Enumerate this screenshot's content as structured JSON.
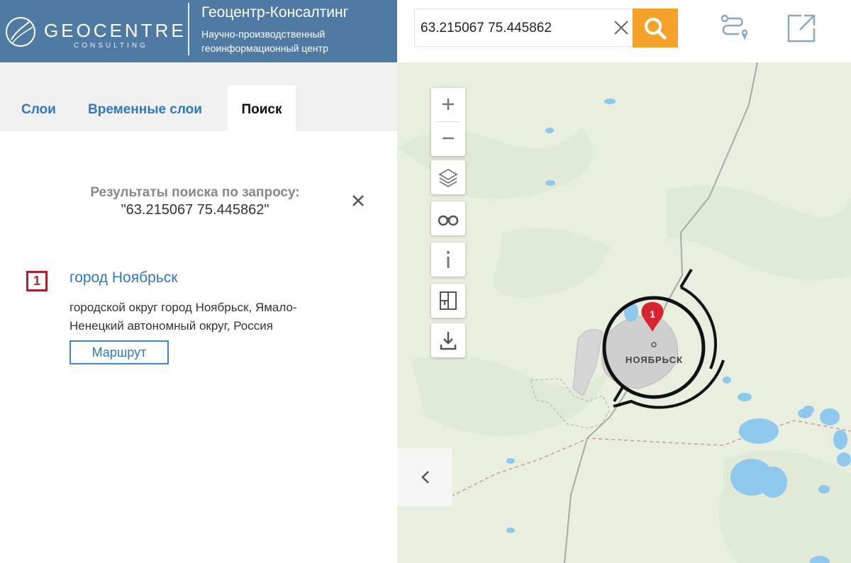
{
  "header": {
    "logo_word": "GEOCENTRE",
    "logo_sub": "CONSULTING",
    "company_name": "Геоцентр-Консалтинг",
    "company_desc_line1": "Научно-производственный",
    "company_desc_line2": "геоинформационный центр"
  },
  "search": {
    "value": "63.215067 75.445862",
    "clear_icon": "close-icon",
    "button_icon": "search-icon",
    "accent_color": "#f5a22b"
  },
  "toolbar": {
    "route_icon": "route-icon",
    "external_icon": "external-link-icon"
  },
  "tabs": [
    {
      "label": "Слои",
      "active": false
    },
    {
      "label": "Временные слои",
      "active": false
    },
    {
      "label": "Поиск",
      "active": true
    }
  ],
  "results": {
    "title": "Результаты поиска по запросу:",
    "query": "\"63.215067 75.445862\"",
    "items": [
      {
        "index": "1",
        "title": "город Ноябрьск",
        "desc_line1": "городской округ город Ноябрьск, Ямало-",
        "desc_line2": "Ненецкий автономный округ, Россия",
        "route_label": "Маршрут"
      }
    ]
  },
  "map": {
    "controls": [
      "zoom-in-icon",
      "zoom-out-icon",
      "layers-icon",
      "binoculars-icon",
      "info-icon",
      "layout-icon",
      "download-icon"
    ],
    "city_label": "НОЯБРЬСК",
    "marker_label": "1",
    "marker_color": "#d9232e",
    "water_color": "#8ec8ec",
    "land_color": "#e8efdf"
  },
  "colors": {
    "header_bg": "#4f7aa3",
    "link": "#2f78bf"
  }
}
